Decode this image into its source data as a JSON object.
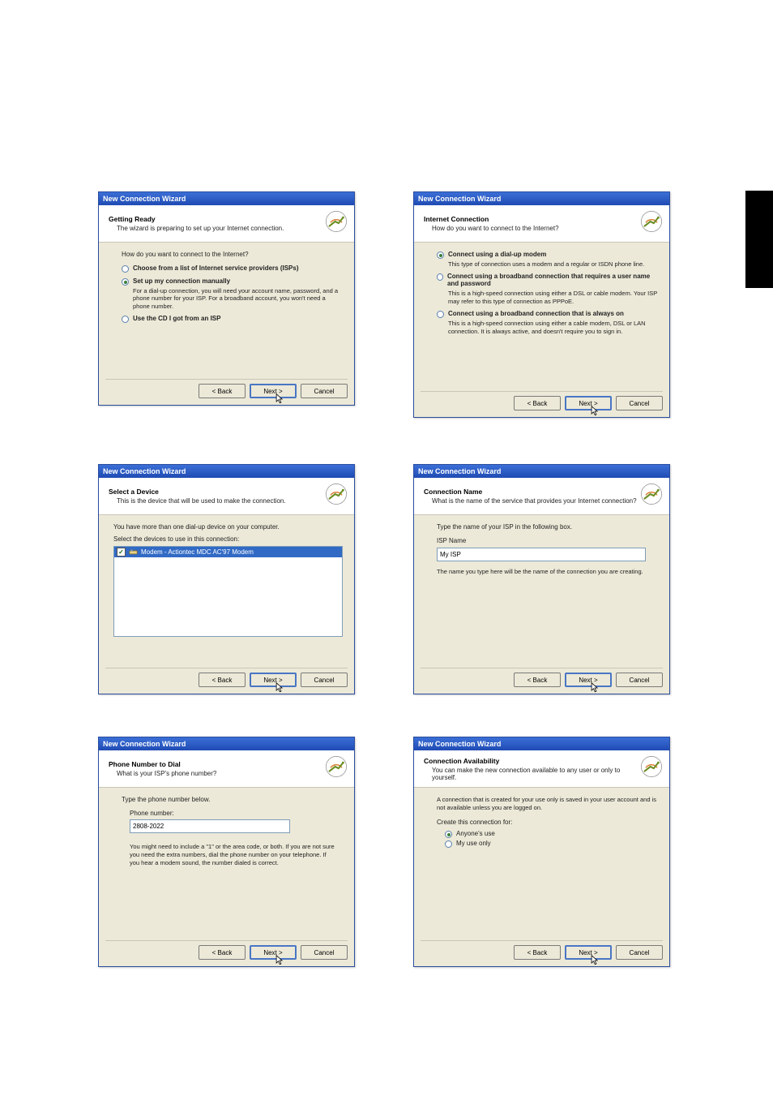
{
  "common": {
    "title": "New Connection Wizard",
    "back": "< Back",
    "next": "Next >",
    "cancel": "Cancel"
  },
  "dlg1": {
    "title": "Getting Ready",
    "sub": "The wizard is preparing to set up your Internet connection.",
    "q": "How do you want to connect to the Internet?",
    "opt1": "Choose from a list of Internet service providers (ISPs)",
    "opt2": "Set up my connection manually",
    "opt2_desc": "For a dial-up connection, you will need your account name, password, and a phone number for your ISP. For a broadband account, you won't need a phone number.",
    "opt3": "Use the CD I got from an ISP"
  },
  "dlg2": {
    "title": "Internet Connection",
    "sub": "How do you want to connect to the Internet?",
    "opt1": "Connect using a dial-up modem",
    "opt1_desc": "This type of connection uses a modem and a regular or ISDN phone line.",
    "opt2": "Connect using a broadband connection that requires a user name and password",
    "opt2_desc": "This is a high-speed connection using either a DSL or cable modem. Your ISP may refer to this type of connection as PPPoE.",
    "opt3": "Connect using a broadband connection that is always on",
    "opt3_desc": "This is a high-speed connection using either a cable modem, DSL or LAN connection. It is always active, and doesn't require you to sign in."
  },
  "dlg3": {
    "title": "Select a Device",
    "sub": "This is the device that will be used to make the connection.",
    "line1": "You have more than one dial-up device on your computer.",
    "line2": "Select the devices to use in this connection:",
    "item": "Modem - Actiontec MDC AC'97 Modem"
  },
  "dlg4": {
    "title": "Connection Name",
    "sub": "What is the name of the service that provides your Internet connection?",
    "line1": "Type the name of your ISP in the following box.",
    "label": "ISP Name",
    "value": "My ISP",
    "hint": "The name you type here will be the name of the connection you are creating."
  },
  "dlg5": {
    "title": "Phone Number to Dial",
    "sub": "What is your ISP's phone number?",
    "line1": "Type the phone number below.",
    "label": "Phone number:",
    "value": "2808-2022",
    "hint": "You might need to include a \"1\" or the area code, or both. If you are not sure you need the extra numbers, dial the phone number on your telephone. If you hear a modem sound, the number dialed is correct."
  },
  "dlg6": {
    "title": "Connection Availability",
    "sub": "You can make the new connection available to any user or only to yourself.",
    "desc": "A connection that is created for your use only is saved in your user account and is not available unless you are logged on.",
    "label": "Create this connection for:",
    "opt1": "Anyone's use",
    "opt2": "My use only"
  }
}
